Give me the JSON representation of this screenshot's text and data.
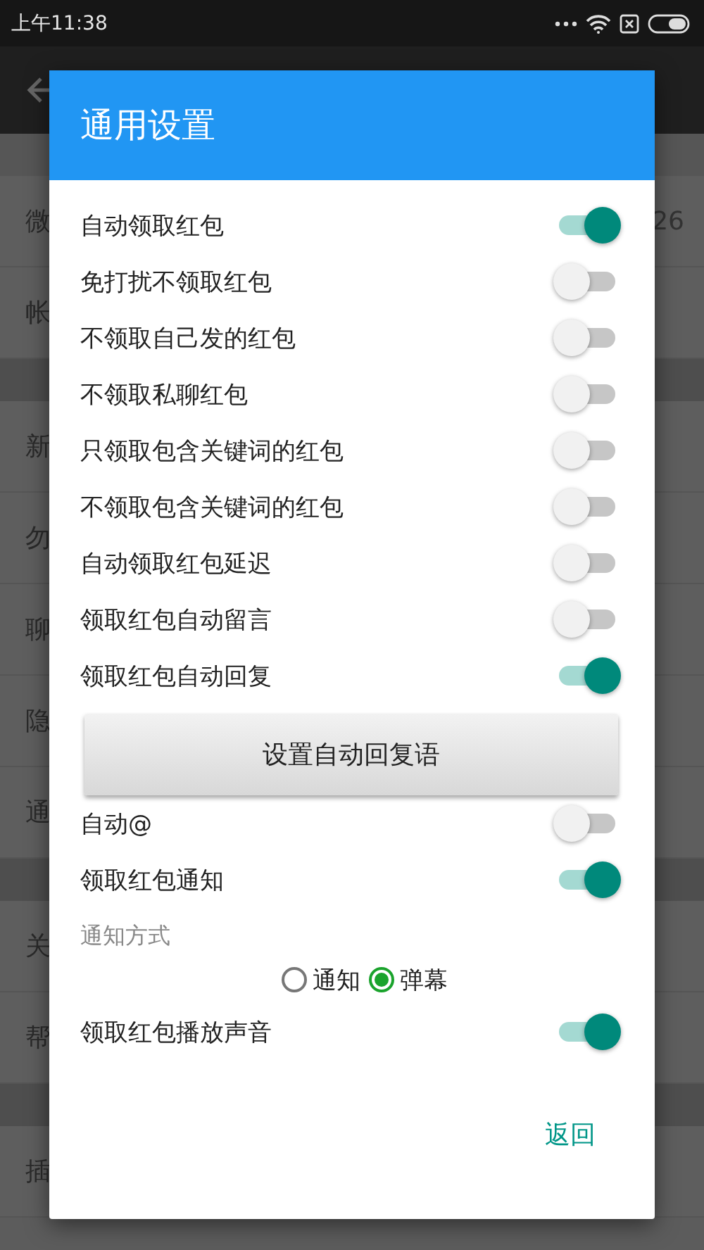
{
  "status_bar": {
    "time": "上午11:38"
  },
  "background": {
    "groups": [
      {
        "items": [
          {
            "label": "微",
            "value": "26"
          },
          {
            "label": "帐"
          }
        ]
      },
      {
        "items": [
          {
            "label": "新"
          },
          {
            "label": "勿"
          },
          {
            "label": "聊"
          },
          {
            "label": "隐"
          },
          {
            "label": "通"
          }
        ]
      },
      {
        "items": [
          {
            "label": "关"
          },
          {
            "label": "帮"
          }
        ]
      },
      {
        "items": [
          {
            "label": "插"
          }
        ]
      }
    ]
  },
  "dialog": {
    "title": "通用设置",
    "items": [
      {
        "kind": "switch",
        "label": "自动领取红包",
        "on": true
      },
      {
        "kind": "switch",
        "label": "免打扰不领取红包",
        "on": false
      },
      {
        "kind": "switch",
        "label": "不领取自己发的红包",
        "on": false
      },
      {
        "kind": "switch",
        "label": "不领取私聊红包",
        "on": false
      },
      {
        "kind": "switch",
        "label": "只领取包含关键词的红包",
        "on": false
      },
      {
        "kind": "switch",
        "label": "不领取包含关键词的红包",
        "on": false
      },
      {
        "kind": "switch",
        "label": "自动领取红包延迟",
        "on": false
      },
      {
        "kind": "switch",
        "label": "领取红包自动留言",
        "on": false
      },
      {
        "kind": "switch",
        "label": "领取红包自动回复",
        "on": true
      },
      {
        "kind": "button",
        "label": "设置自动回复语"
      },
      {
        "kind": "switch",
        "label": "自动@",
        "on": false
      },
      {
        "kind": "switch",
        "label": "领取红包通知",
        "on": true
      },
      {
        "kind": "radio_group",
        "label": "通知方式",
        "options": [
          {
            "label": "通知",
            "selected": false
          },
          {
            "label": "弹幕",
            "selected": true
          }
        ]
      },
      {
        "kind": "switch",
        "label": "领取红包播放声音",
        "on": true
      }
    ],
    "actions": [
      "返回"
    ]
  }
}
